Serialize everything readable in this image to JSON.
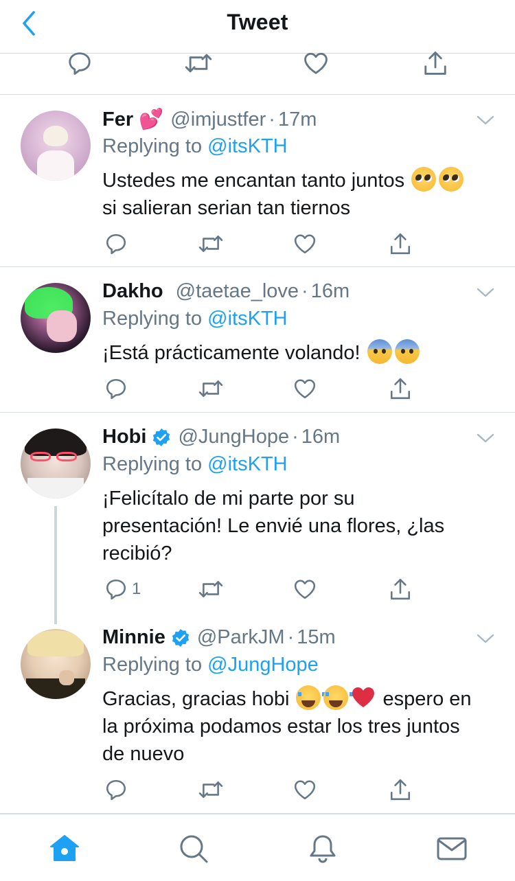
{
  "header": {
    "title": "Tweet",
    "back_icon": "chevron-left-icon",
    "accent": "#1da1f2"
  },
  "colors": {
    "accent": "#1da1f2",
    "secondary_text": "#657786",
    "divider": "#d8dde1",
    "text": "#14171a"
  },
  "tweets": [
    {
      "name": "Fer",
      "name_emoji": "💕",
      "handle": "@imjustfer",
      "time": "17m",
      "reply_prefix": "Replying to",
      "reply_to": "@itsKTH",
      "body_1": "Ustedes me encantan tanto juntos",
      "body_2": "si salieran serian tan tiernos",
      "verified": false
    },
    {
      "name": "Dakho",
      "handle": "@taetae_love",
      "time": "16m",
      "reply_prefix": "Replying to",
      "reply_to": "@itsKTH",
      "body_1": "¡Está prácticamente volando!",
      "verified": false
    },
    {
      "name": "Hobi",
      "handle": "@JungHope",
      "time": "16m",
      "reply_prefix": "Replying to",
      "reply_to": "@itsKTH",
      "body_1": "¡Felicítalo de mi parte por su",
      "body_2": "presentación! Le envié una flores, ¿las",
      "body_3": "recibió?",
      "reply_count": "1",
      "verified": true
    },
    {
      "name": "Minnie",
      "handle": "@ParkJM",
      "time": "15m",
      "reply_prefix": "Replying to",
      "reply_to": "@JungHope",
      "body_1a": "Gracias, gracias hobi",
      "body_1b": "espero en",
      "body_2": "la próxima podamos estar los tres juntos",
      "body_3": "de nuevo",
      "verified": true
    }
  ],
  "separator": "·",
  "tabbar": {
    "items": [
      "home-icon",
      "search-icon",
      "notifications-icon",
      "messages-icon"
    ]
  }
}
